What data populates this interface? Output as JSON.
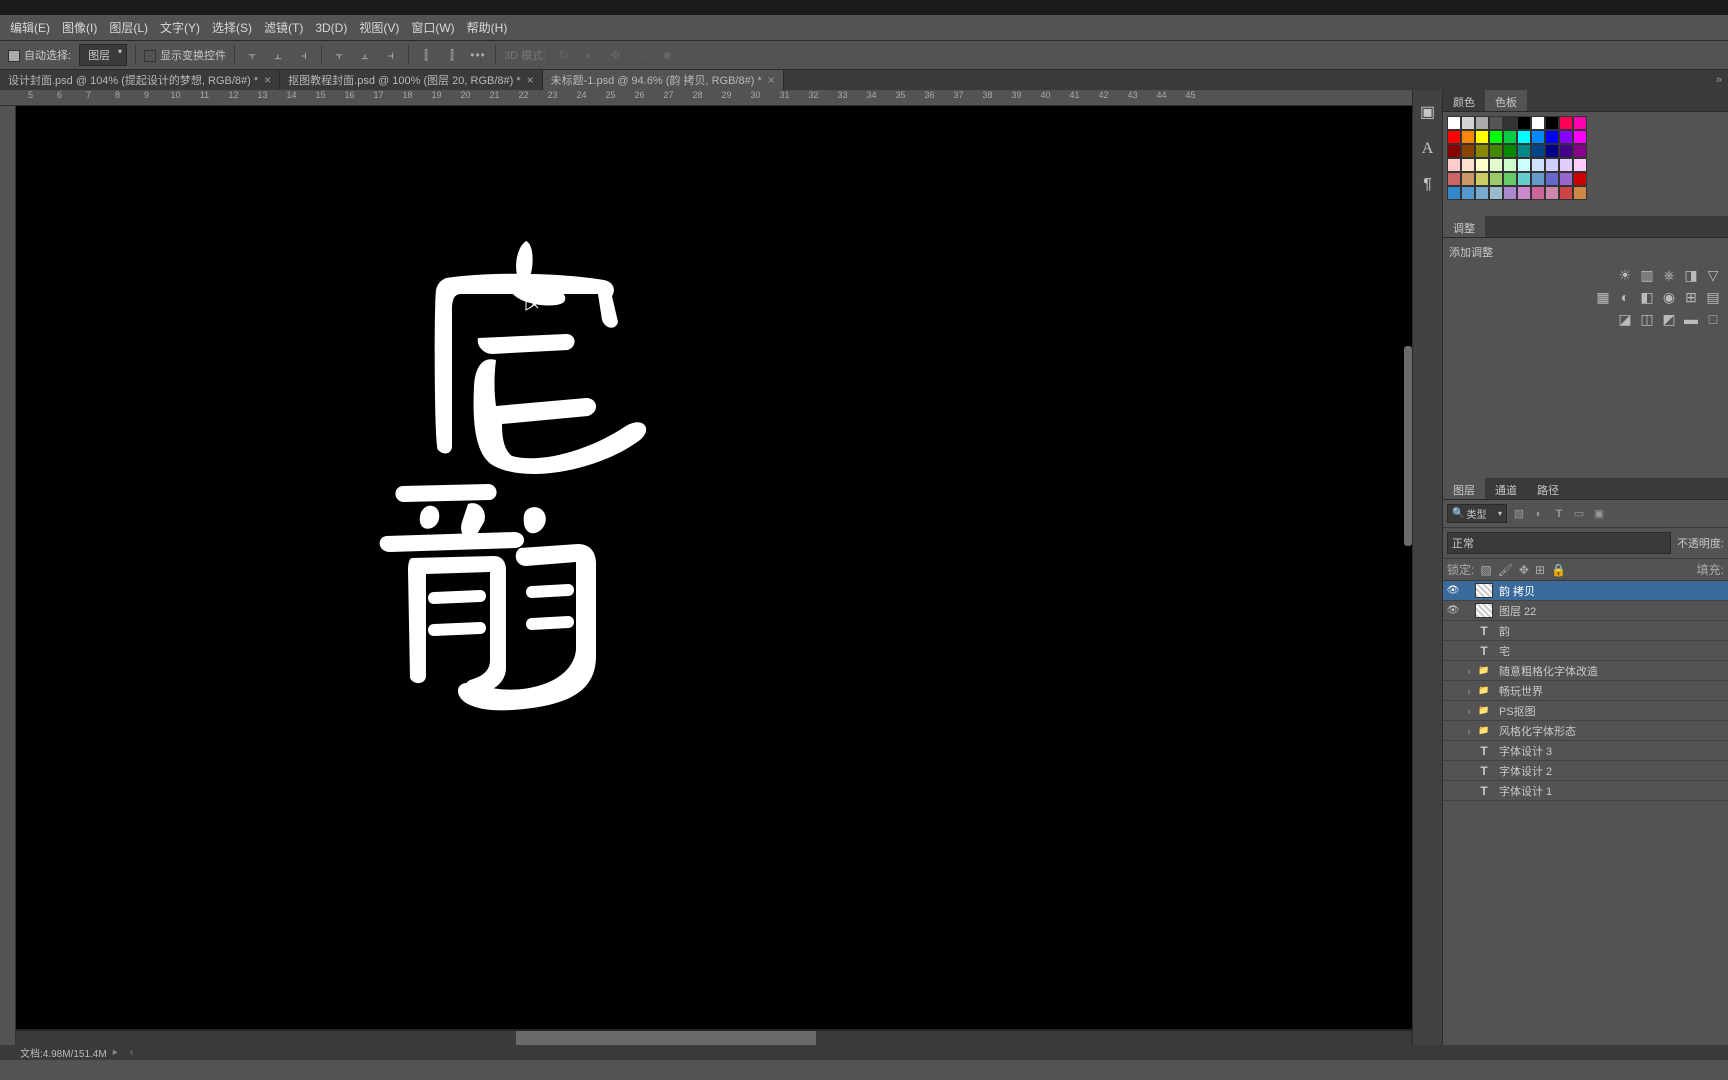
{
  "menu": {
    "items": [
      "编辑(E)",
      "图像(I)",
      "图层(L)",
      "文字(Y)",
      "选择(S)",
      "滤镜(T)",
      "3D(D)",
      "视图(V)",
      "窗口(W)",
      "帮助(H)"
    ]
  },
  "options": {
    "autoSelect": "自动选择:",
    "target": "图层",
    "transform": "显示变换控件",
    "mode3d": "3D 模式:"
  },
  "tabs": [
    {
      "label": "设计封面.psd @ 104% (提起设计的梦想, RGB/8#) *"
    },
    {
      "label": "抠图教程封面.psd @ 100% (图层 20, RGB/8#) *"
    },
    {
      "label": "未标题-1.psd @ 94.6% (韵 拷贝, RGB/8#) *",
      "active": true
    }
  ],
  "ruler": [
    "5",
    "6",
    "7",
    "8",
    "9",
    "10",
    "11",
    "12",
    "13",
    "14",
    "15",
    "16",
    "17",
    "18",
    "19",
    "20",
    "21",
    "22",
    "23",
    "24",
    "25",
    "26",
    "27",
    "28",
    "29",
    "30",
    "31",
    "32",
    "33",
    "34",
    "35",
    "36",
    "37",
    "38",
    "39",
    "40",
    "41",
    "42",
    "43",
    "44",
    "45"
  ],
  "rightTabs": {
    "swatches": [
      "颜色",
      "色板"
    ],
    "adjust": [
      "调整"
    ],
    "addAdjust": "添加调整",
    "layers": [
      "图层",
      "通道",
      "路径"
    ]
  },
  "swatches": [
    [
      "#ffffff",
      "#d4d4d4",
      "#aaaaaa",
      "#555555",
      "#333333",
      "#000000",
      "#ffffff",
      "#000000",
      "#ff0055",
      "#ff00aa"
    ],
    [
      "#ff0000",
      "#ff8800",
      "#ffff00",
      "#00ff00",
      "#00cc44",
      "#00ffff",
      "#0088ff",
      "#0000ff",
      "#8800ff",
      "#ff00ff"
    ],
    [
      "#880000",
      "#884400",
      "#888800",
      "#448800",
      "#008800",
      "#008888",
      "#004488",
      "#000088",
      "#440088",
      "#880088"
    ],
    [
      "#ffcccc",
      "#ffe0cc",
      "#ffffcc",
      "#e0ffcc",
      "#ccffcc",
      "#ccffff",
      "#cce0ff",
      "#ccccff",
      "#e0ccff",
      "#ffccff"
    ],
    [
      "#cc6666",
      "#cc9966",
      "#cccc66",
      "#99cc66",
      "#66cc66",
      "#66cccc",
      "#6699cc",
      "#6666cc",
      "#9966cc",
      "#cc0000"
    ],
    [
      "#3388cc",
      "#5599cc",
      "#77aacc",
      "#99bbcc",
      "#aa88cc",
      "#cc88cc",
      "#cc6699",
      "#cc88aa",
      "#cc4444",
      "#cc8844"
    ]
  ],
  "layersPanel": {
    "filterLabel": "类型",
    "blend": "正常",
    "opacity": "不透明度:",
    "lockLabel": "锁定:",
    "fill": "填充:"
  },
  "layers": [
    {
      "vis": true,
      "kind": "raster",
      "name": "韵 拷贝",
      "selected": true
    },
    {
      "vis": true,
      "kind": "raster",
      "name": "图层 22"
    },
    {
      "vis": false,
      "kind": "text",
      "name": "韵"
    },
    {
      "vis": false,
      "kind": "text",
      "name": "宅"
    },
    {
      "vis": false,
      "kind": "folder",
      "name": "随意粗格化字体改造",
      "exp": true
    },
    {
      "vis": false,
      "kind": "folder",
      "name": "畅玩世界",
      "exp": true
    },
    {
      "vis": false,
      "kind": "folder",
      "name": "PS抠图",
      "exp": true
    },
    {
      "vis": false,
      "kind": "folder",
      "name": "风格化字体形态",
      "exp": true
    },
    {
      "vis": false,
      "kind": "text",
      "name": "字体设计 3"
    },
    {
      "vis": false,
      "kind": "text",
      "name": "字体设计 2"
    },
    {
      "vis": false,
      "kind": "text",
      "name": "字体设计 1"
    }
  ],
  "status": "文档:4.98M/151.4M"
}
